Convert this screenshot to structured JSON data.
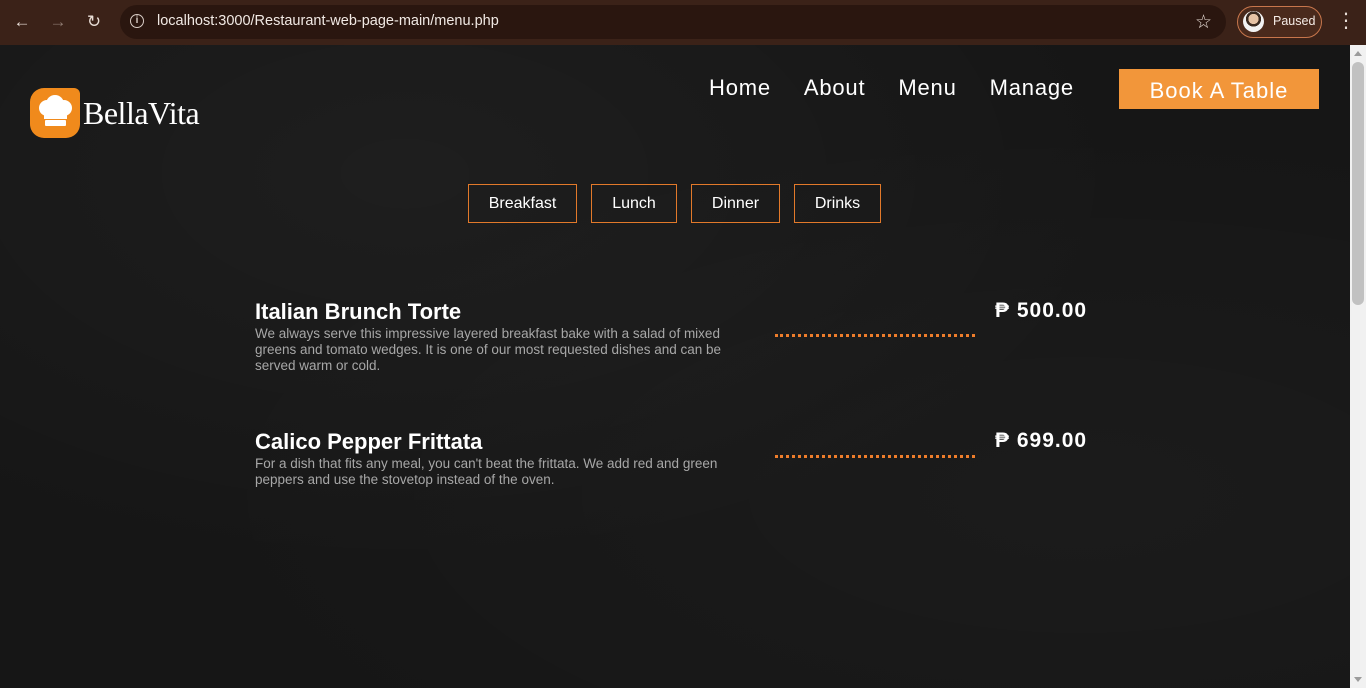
{
  "browser": {
    "url": "localhost:3000/Restaurant-web-page-main/menu.php",
    "profile_status": "Paused",
    "icons": {
      "back": "arrow-left-icon",
      "forward": "arrow-right-icon",
      "reload": "reload-icon",
      "info": "info-icon",
      "bookmark": "star-icon",
      "menu": "kebab-menu-icon"
    }
  },
  "brand": {
    "name": "BellaVita",
    "logo_icon": "chef-hat-icon",
    "accent_color": "#f2963a"
  },
  "nav": {
    "links": [
      "Home",
      "About",
      "Menu",
      "Manage"
    ],
    "cta_label": "Book A Table"
  },
  "menu_tabs": [
    "Breakfast",
    "Lunch",
    "Dinner",
    "Drinks"
  ],
  "menu_items": [
    {
      "name": "Italian Brunch Torte",
      "description": "We always serve this impressive layered breakfast bake with a salad of mixed greens and tomato wedges. It is one of our most requested dishes and can be served warm or cold.",
      "price": "₱ 500.00"
    },
    {
      "name": "Calico Pepper Frittata",
      "description": "For a dish that fits any meal, you can't beat the frittata. We add red and green peppers and use the stovetop instead of the oven.",
      "price": "₱ 699.00"
    }
  ]
}
